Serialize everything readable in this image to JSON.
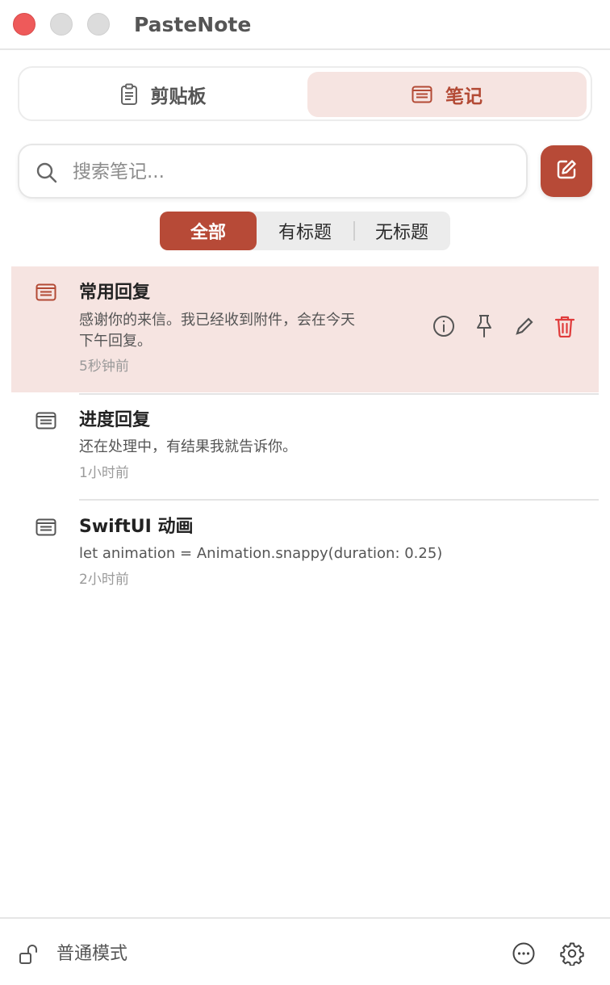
{
  "app": {
    "title": "PasteNote"
  },
  "main_tabs": [
    {
      "label": "剪贴板",
      "icon": "clipboard-icon",
      "active": false
    },
    {
      "label": "笔记",
      "icon": "note-icon",
      "active": true
    }
  ],
  "search": {
    "placeholder": "搜索笔记...",
    "value": ""
  },
  "filter": {
    "options": [
      "全部",
      "有标题",
      "无标题"
    ],
    "selected": "全部"
  },
  "notes": [
    {
      "title": "常用回复",
      "content_lines": [
        "感谢你的来信。我已经收到附件，会在今天",
        "下午回复。"
      ],
      "time": "5秒钟前",
      "selected": true
    },
    {
      "title": "进度回复",
      "content_lines": [
        "还在处理中，有结果我就告诉你。"
      ],
      "time": "1小时前",
      "selected": false
    },
    {
      "title": "SwiftUI 动画",
      "content_lines": [
        "let animation = Animation.snappy(duration: 0.25)"
      ],
      "time": "2小时前",
      "selected": false
    }
  ],
  "footer": {
    "mode_label": "普通模式",
    "mode_icon": "unlock-icon"
  },
  "colors": {
    "accent": "#b74a37",
    "accent_soft": "#f6e4e1",
    "delete": "#e03b3b"
  }
}
